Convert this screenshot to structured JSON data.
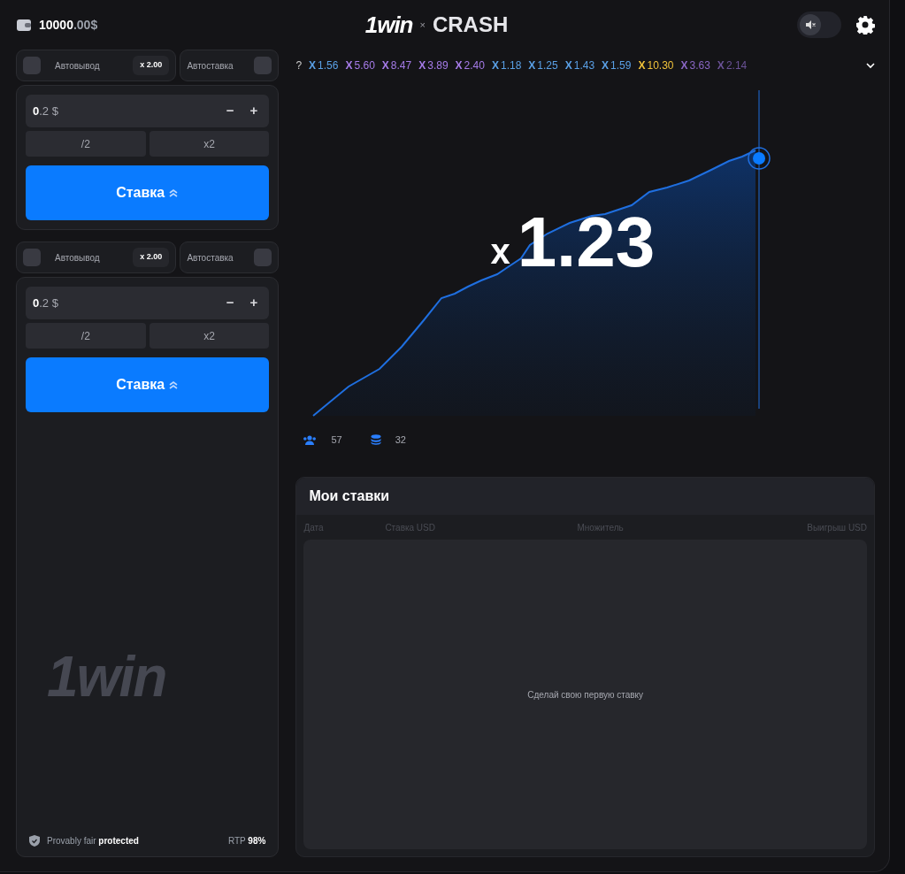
{
  "header": {
    "balance": "**10000**.00$",
    "logo_left": "1win",
    "logo_sep": "×",
    "logo_right": "CRASH",
    "sound_on": false
  },
  "bet_panels": [
    {
      "autocashout_label": "Автовывод",
      "autocashout_checked": false,
      "autocashout_value": "x 2.00",
      "autobet_label": "Автоставка",
      "autobet_checked": false,
      "amount": "**0**.2 $",
      "minus": "−",
      "plus": "+",
      "half": "/2",
      "double": "x2",
      "bet_button": "Ставка"
    },
    {
      "autocashout_label": "Автовывод",
      "autocashout_checked": false,
      "autocashout_value": "x 2.00",
      "autobet_label": "Автоставка",
      "autobet_checked": false,
      "amount": "**0**.2 $",
      "minus": "−",
      "plus": "+",
      "half": "/2",
      "double": "x2",
      "bet_button": "Ставка"
    }
  ],
  "panel_logo": "1win",
  "footer": {
    "fair": "Provably fair **protected**",
    "rtp": "RTP **98%**"
  },
  "history": {
    "help": "?",
    "items": [
      {
        "x": "X",
        "value": "1.56",
        "color": "#5aa0e6"
      },
      {
        "x": "X",
        "value": "5.60",
        "color": "#a57be8"
      },
      {
        "x": "X",
        "value": "8.47",
        "color": "#a57be8"
      },
      {
        "x": "X",
        "value": "3.89",
        "color": "#a57be8"
      },
      {
        "x": "X",
        "value": "2.40",
        "color": "#a57be8"
      },
      {
        "x": "X",
        "value": "1.18",
        "color": "#5aa0e6"
      },
      {
        "x": "X",
        "value": "1.25",
        "color": "#5aa0e6"
      },
      {
        "x": "X",
        "value": "1.43",
        "color": "#5aa0e6"
      },
      {
        "x": "X",
        "value": "1.59",
        "color": "#5aa0e6"
      },
      {
        "x": "X",
        "value": "10.30",
        "color": "#f0c23a"
      },
      {
        "x": "X",
        "value": "3.63",
        "color": "#8a66c4"
      },
      {
        "x": "X",
        "value": "2.14",
        "color": "#6a5296"
      }
    ]
  },
  "game": {
    "prefix": "x",
    "multiplier": "1.23",
    "players": "57",
    "bets": "32"
  },
  "my_bets": {
    "title": "Мои ставки",
    "columns": [
      "Дата",
      "Ставка USD",
      "Множитель",
      "Выигрыш USD"
    ],
    "empty": "Сделай свою первую ставку"
  }
}
